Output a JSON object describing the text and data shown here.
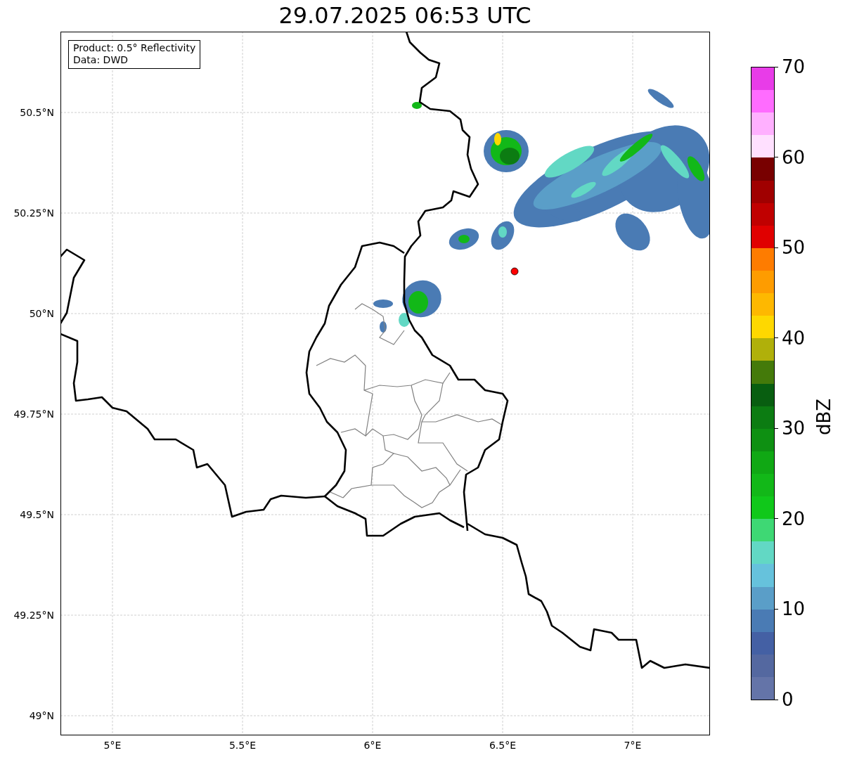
{
  "title": "29.07.2025 06:53 UTC",
  "map": {
    "info_box": [
      "Product: 0.5° Reflectivity",
      "Data: DWD"
    ],
    "lat_ticks": [
      "50.5°N",
      "50.25°N",
      "50°N",
      "49.75°N",
      "49.5°N",
      "49.25°N",
      "49°N"
    ],
    "lon_ticks": [
      "5°E",
      "5.5°E",
      "6°E",
      "6.5°E",
      "7°E"
    ]
  },
  "colorbar": {
    "label": "dBZ",
    "ticks": [
      "70",
      "60",
      "50",
      "40",
      "30",
      "20",
      "10",
      "0"
    ],
    "segments": [
      {
        "color": "#e83ce8"
      },
      {
        "color": "#ff6cff"
      },
      {
        "color": "#ffb0ff"
      },
      {
        "color": "#ffe0ff"
      },
      {
        "color": "#780000"
      },
      {
        "color": "#a00000"
      },
      {
        "color": "#c00000"
      },
      {
        "color": "#e00000"
      },
      {
        "color": "#fe7c00"
      },
      {
        "color": "#fe9c00"
      },
      {
        "color": "#feb800"
      },
      {
        "color": "#fed800"
      },
      {
        "color": "#b0b00a"
      },
      {
        "color": "#447a0a"
      },
      {
        "color": "#085e10"
      },
      {
        "color": "#0c7c12"
      },
      {
        "color": "#0e9012"
      },
      {
        "color": "#10a814"
      },
      {
        "color": "#12b818"
      },
      {
        "color": "#10c81a"
      },
      {
        "color": "#3ed874"
      },
      {
        "color": "#62d8c4"
      },
      {
        "color": "#66c2dc"
      },
      {
        "color": "#5a9ec8"
      },
      {
        "color": "#4a7bb4"
      },
      {
        "color": "#4460a4"
      },
      {
        "color": "#5468a0"
      },
      {
        "color": "#6474a8"
      }
    ]
  }
}
